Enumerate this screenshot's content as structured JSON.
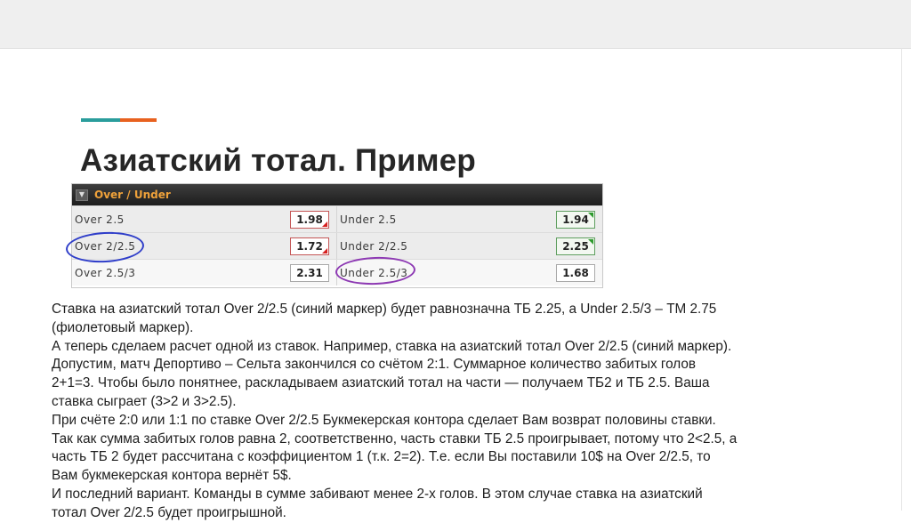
{
  "slide": {
    "title": "Азиатский тотал. Пример"
  },
  "odds_table": {
    "header": "Over / Under",
    "rows": [
      {
        "left_label": "Over  2.5",
        "left_odd": "1.98",
        "left_trend": "down",
        "right_label": "Under  2.5",
        "right_odd": "1.94",
        "right_trend": "up"
      },
      {
        "left_label": "Over  2/2.5",
        "left_odd": "1.72",
        "left_trend": "down",
        "right_label": "Under  2/2.5",
        "right_odd": "2.25",
        "right_trend": "up"
      },
      {
        "left_label": "Over  2.5/3",
        "left_odd": "2.31",
        "left_trend": "none",
        "right_label": "Under  2.5/3",
        "right_odd": "1.68",
        "right_trend": "none"
      }
    ],
    "colors": {
      "header_text": "#f0a23a",
      "blue_marker": "#2f3ec9",
      "purple_marker": "#8d39b3",
      "down": "#d62020",
      "up": "#2e9a2e"
    }
  },
  "body": {
    "lines": [
      "Ставка на азиатский тотал Over 2/2.5 (синий маркер) будет равнозначна ТБ 2.25, а Under 2.5/3 – ТМ 2.75",
      "(фиолетовый маркер).",
      "А теперь сделаем расчет одной из ставок. Например, ставка на азиатский тотал Over 2/2.5 (синий маркер).",
      "Допустим, матч Депортиво – Сельта закончился со счётом 2:1. Суммарное количество забитых голов",
      "2+1=3. Чтобы было понятнее, раскладываем азиатский тотал на части — получаем ТБ2 и ТБ 2.5. Ваша",
      "ставка сыграет (3>2 и 3>2.5).",
      "При счёте 2:0 или 1:1 по ставке Over 2/2.5 Букмекерская контора сделает Вам возврат половины ставки.",
      "Так как сумма забитых голов равна 2, соответственно, часть ставки ТБ 2.5 проигрывает, потому что 2<2.5, а",
      "часть ТБ 2 будет рассчитана с коэффициентом 1 (т.к. 2=2). Т.е. если Вы поставили 10$ на Over 2/2.5, то",
      "Вам букмекерская контора вернёт 5$.",
      "И последний вариант. Команды в сумме забивают менее 2-х голов. В этом случае ставка на азиатский",
      "тотал Over 2/2.5 будет проигрышной."
    ]
  }
}
